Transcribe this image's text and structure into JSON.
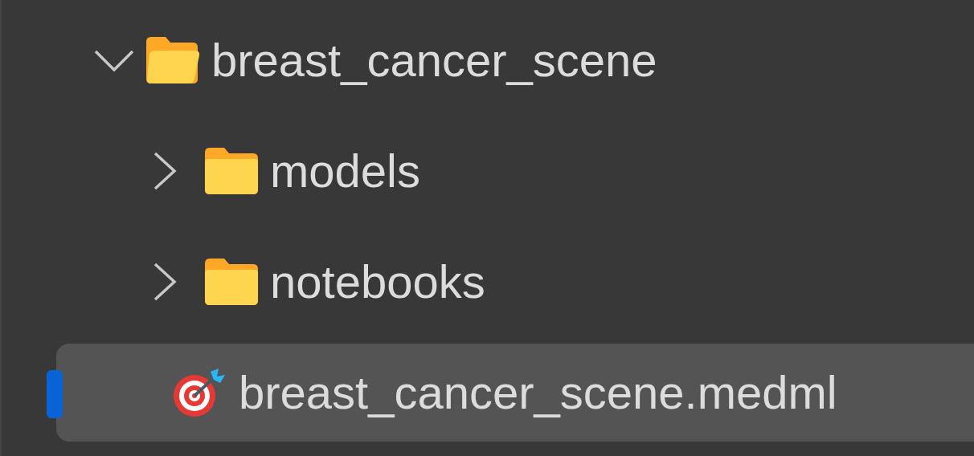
{
  "explorer": {
    "tree": [
      {
        "name": "breast_cancer_scene",
        "kind": "folder",
        "expanded": true,
        "selected": false,
        "children": [
          {
            "name": "models",
            "kind": "folder",
            "expanded": false,
            "selected": false
          },
          {
            "name": "notebooks",
            "kind": "folder",
            "expanded": false,
            "selected": false
          },
          {
            "name": "breast_cancer_scene.medml",
            "kind": "file",
            "selected": true
          }
        ]
      }
    ]
  }
}
